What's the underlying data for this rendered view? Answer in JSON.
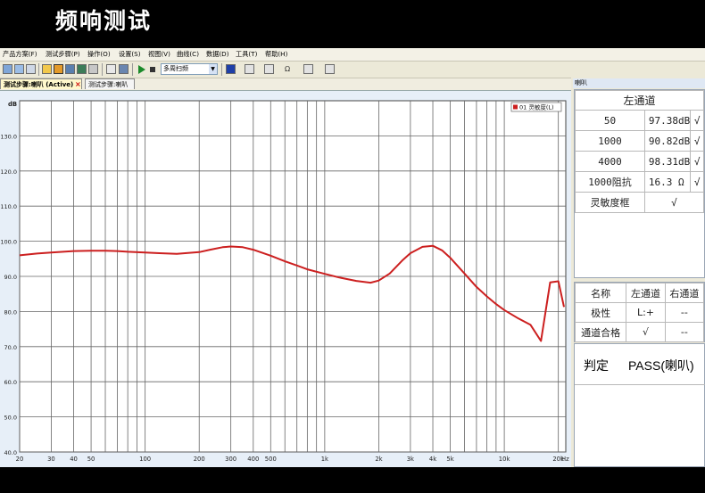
{
  "banner": {
    "title": "频响测试"
  },
  "menu": [
    "产品方案(F)",
    "测试步骤(P)",
    "操作(O)",
    "设置(S)",
    "视图(V)",
    "曲线(C)",
    "数据(D)",
    "工具(T)",
    "帮助(H)"
  ],
  "toolbar": {
    "scan_mode": "多周扫频",
    "dropdown_arrow": "▼",
    "omega": "Ω"
  },
  "tabs": {
    "active": "测试步骤:喇叭 (Active)",
    "close": "×",
    "second": "测试步骤:喇叭"
  },
  "side_panel": {
    "header": "喇叭",
    "left_channel": "左通道",
    "rows": [
      {
        "freq": "50",
        "value": "97.38dB",
        "check": "√"
      },
      {
        "freq": "1000",
        "value": "90.82dB",
        "check": "√"
      },
      {
        "freq": "4000",
        "value": "98.31dB",
        "check": "√"
      },
      {
        "freq": "1000阻抗",
        "value": "16.3 Ω",
        "check": "√"
      }
    ],
    "sensitivity_label": "灵敏度框",
    "sensitivity_check": "√",
    "table2": {
      "headers": [
        "名称",
        "左通道",
        "右通道"
      ],
      "rows": [
        [
          "极性",
          "L:+",
          "--"
        ],
        [
          "通道合格",
          "√",
          "--"
        ]
      ]
    },
    "verdict_label": "判定",
    "verdict_value": "PASS(喇叭)"
  },
  "colors": {
    "curve": "#cc1f1f",
    "grid": "#666666",
    "plot_bg": "#ffffff"
  },
  "chart_data": {
    "type": "line",
    "title": "",
    "xlabel": "Hz",
    "ylabel": "dB",
    "x_scale": "log",
    "xlim": [
      20,
      22000
    ],
    "ylim": [
      40,
      140
    ],
    "y_ticks": [
      "40.0",
      "50.0",
      "60.0",
      "70.0",
      "80.0",
      "90.0",
      "100.0",
      "110.0",
      "120.0",
      "130.0"
    ],
    "x_ticks": [
      {
        "v": 20,
        "t": "20"
      },
      {
        "v": 30,
        "t": "30"
      },
      {
        "v": 40,
        "t": "40"
      },
      {
        "v": 50,
        "t": "50"
      },
      {
        "v": 100,
        "t": "100"
      },
      {
        "v": 200,
        "t": "200"
      },
      {
        "v": 300,
        "t": "300"
      },
      {
        "v": 400,
        "t": "400"
      },
      {
        "v": 500,
        "t": "500"
      },
      {
        "v": 1000,
        "t": "1k"
      },
      {
        "v": 2000,
        "t": "2k"
      },
      {
        "v": 3000,
        "t": "3k"
      },
      {
        "v": 4000,
        "t": "4k"
      },
      {
        "v": 5000,
        "t": "5k"
      },
      {
        "v": 10000,
        "t": "10k"
      },
      {
        "v": 20000,
        "t": "20k"
      }
    ],
    "legend_position": "top-right",
    "series": [
      {
        "name": "01 灵敏度(L)",
        "x": [
          20,
          25,
          30,
          40,
          50,
          60,
          70,
          80,
          100,
          120,
          150,
          200,
          230,
          270,
          300,
          350,
          400,
          500,
          600,
          700,
          800,
          1000,
          1200,
          1500,
          1800,
          2000,
          2300,
          2700,
          3000,
          3500,
          4000,
          4500,
          5000,
          6000,
          7000,
          8000,
          9000,
          10000,
          12000,
          14000,
          16000,
          18000,
          20000,
          21500
        ],
        "y": [
          96.0,
          96.5,
          96.8,
          97.2,
          97.3,
          97.3,
          97.2,
          97.0,
          96.8,
          96.6,
          96.4,
          96.9,
          97.6,
          98.3,
          98.5,
          98.3,
          97.6,
          95.9,
          94.3,
          93.1,
          92.0,
          90.7,
          89.7,
          88.7,
          88.2,
          88.8,
          90.8,
          94.5,
          96.6,
          98.4,
          98.7,
          97.4,
          95.3,
          90.8,
          87.0,
          84.3,
          82.1,
          80.4,
          78.0,
          76.2,
          71.6,
          88.3,
          88.6,
          81.3
        ]
      }
    ]
  }
}
